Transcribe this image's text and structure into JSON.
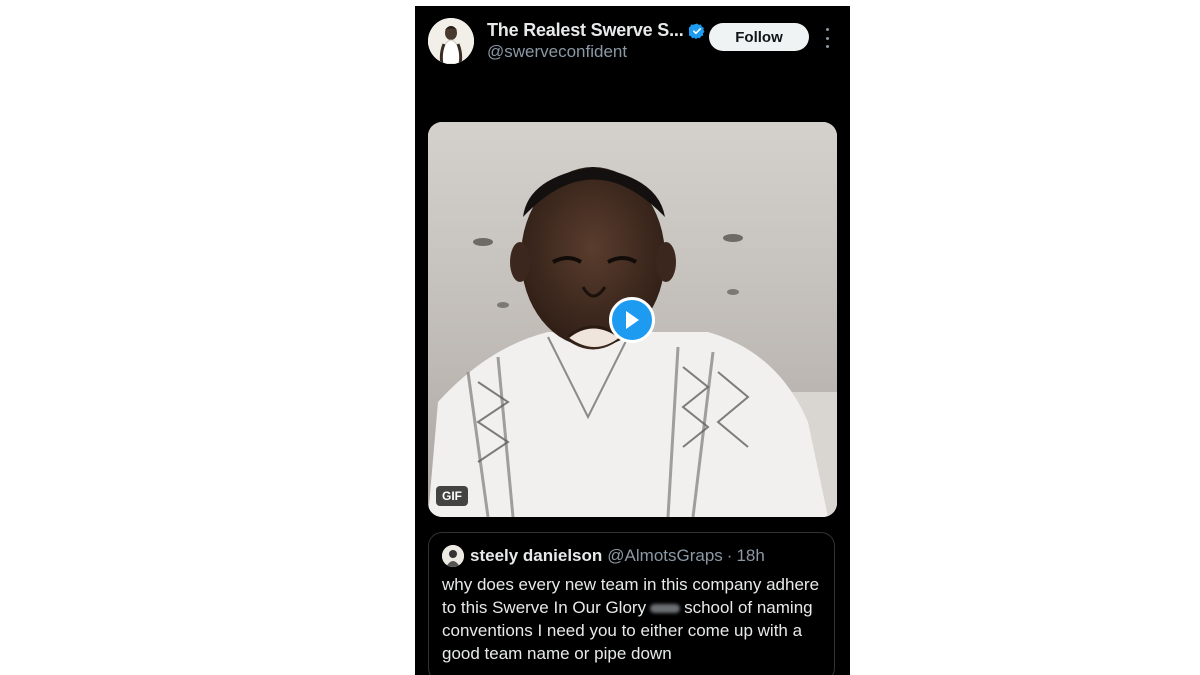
{
  "post": {
    "author": {
      "display_name": "The Realest Swerve S...",
      "handle": "@swerveconfident",
      "verified_icon": "verified-badge-icon",
      "avatar_icon": "avatar-image"
    },
    "follow_label": "Follow",
    "more_icon": "more-options-icon"
  },
  "media": {
    "badge": "GIF",
    "play_icon": "play-icon"
  },
  "quote": {
    "display_name": "steely danielson",
    "handle": "@AlmotsGraps",
    "separator": "·",
    "time": "18h",
    "text_before": "why does every new team in this company adhere to this Swerve In Our Glory",
    "text_after": "school of naming conventions I need you to either come up with a good team name or pipe down"
  },
  "colors": {
    "background": "#000000",
    "accent": "#1d9bf0",
    "text_primary": "#e7e9ea",
    "text_secondary": "#8b98a5"
  }
}
